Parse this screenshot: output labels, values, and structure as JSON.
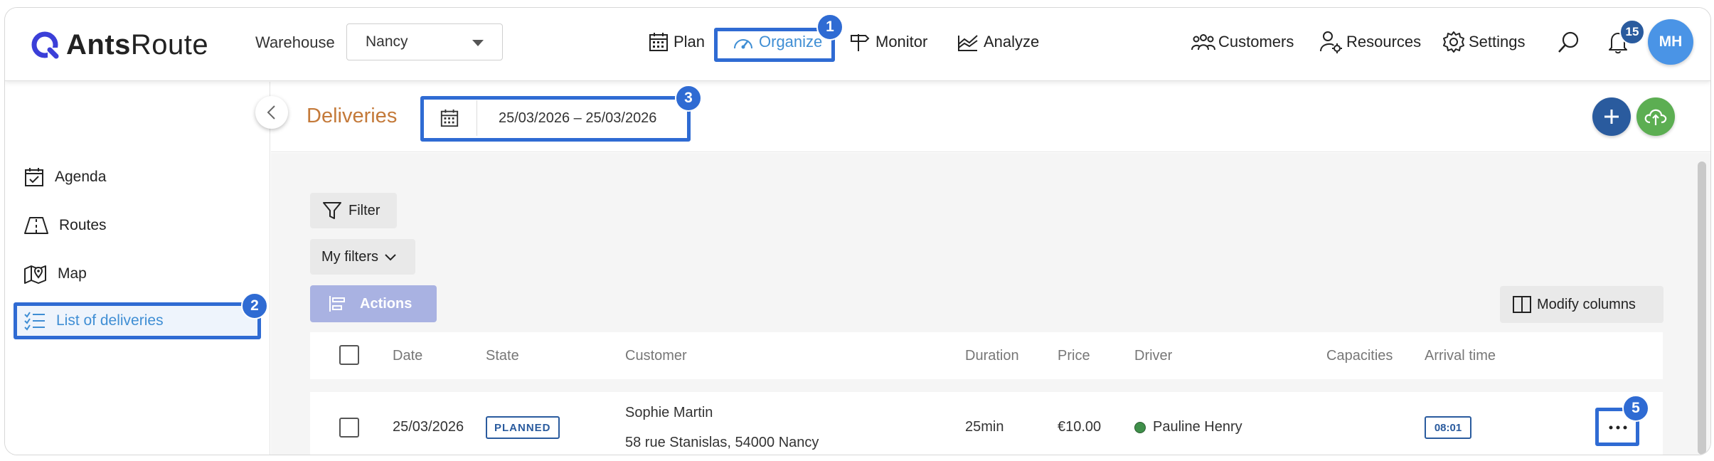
{
  "header": {
    "logo_bold": "Ants",
    "logo_light": "Route",
    "warehouse_label": "Warehouse",
    "warehouse_value": "Nancy",
    "nav": {
      "plan": "Plan",
      "organize": "Organize",
      "monitor": "Monitor",
      "analyze": "Analyze"
    },
    "right": {
      "customers": "Customers",
      "resources": "Resources",
      "settings": "Settings"
    },
    "notification_count": "15",
    "avatar_initials": "MH"
  },
  "sidebar": {
    "items": [
      {
        "label": "Agenda",
        "icon": "calendar-check-icon"
      },
      {
        "label": "Routes",
        "icon": "road-icon"
      },
      {
        "label": "Map",
        "icon": "map-pin-icon"
      },
      {
        "label": "List of deliveries",
        "icon": "checklist-icon"
      }
    ]
  },
  "toolbar": {
    "title": "Deliveries",
    "date_range": "25/03/2026 – 25/03/2026"
  },
  "list": {
    "filter_label": "Filter",
    "my_filters_label": "My filters",
    "actions_label": "Actions",
    "modify_columns_label": "Modify columns",
    "columns": [
      "Date",
      "State",
      "Customer",
      "Duration",
      "Price",
      "Driver",
      "Capacities",
      "Arrival time"
    ],
    "rows": [
      {
        "date": "25/03/2026",
        "state": "PLANNED",
        "customer_name": "Sophie Martin",
        "customer_address": "58 rue Stanislas, 54000 Nancy",
        "duration": "25min",
        "price": "€10.00",
        "driver": "Pauline Henry",
        "arrival_time": "08:01"
      }
    ]
  },
  "annotations": [
    "1",
    "2",
    "3",
    "5"
  ],
  "colors": {
    "accent": "#3f8ed4",
    "highlight": "#2f6bd3",
    "title": "#c47a3a",
    "add_button": "#2a5b9e",
    "upload_button": "#5cae52"
  }
}
